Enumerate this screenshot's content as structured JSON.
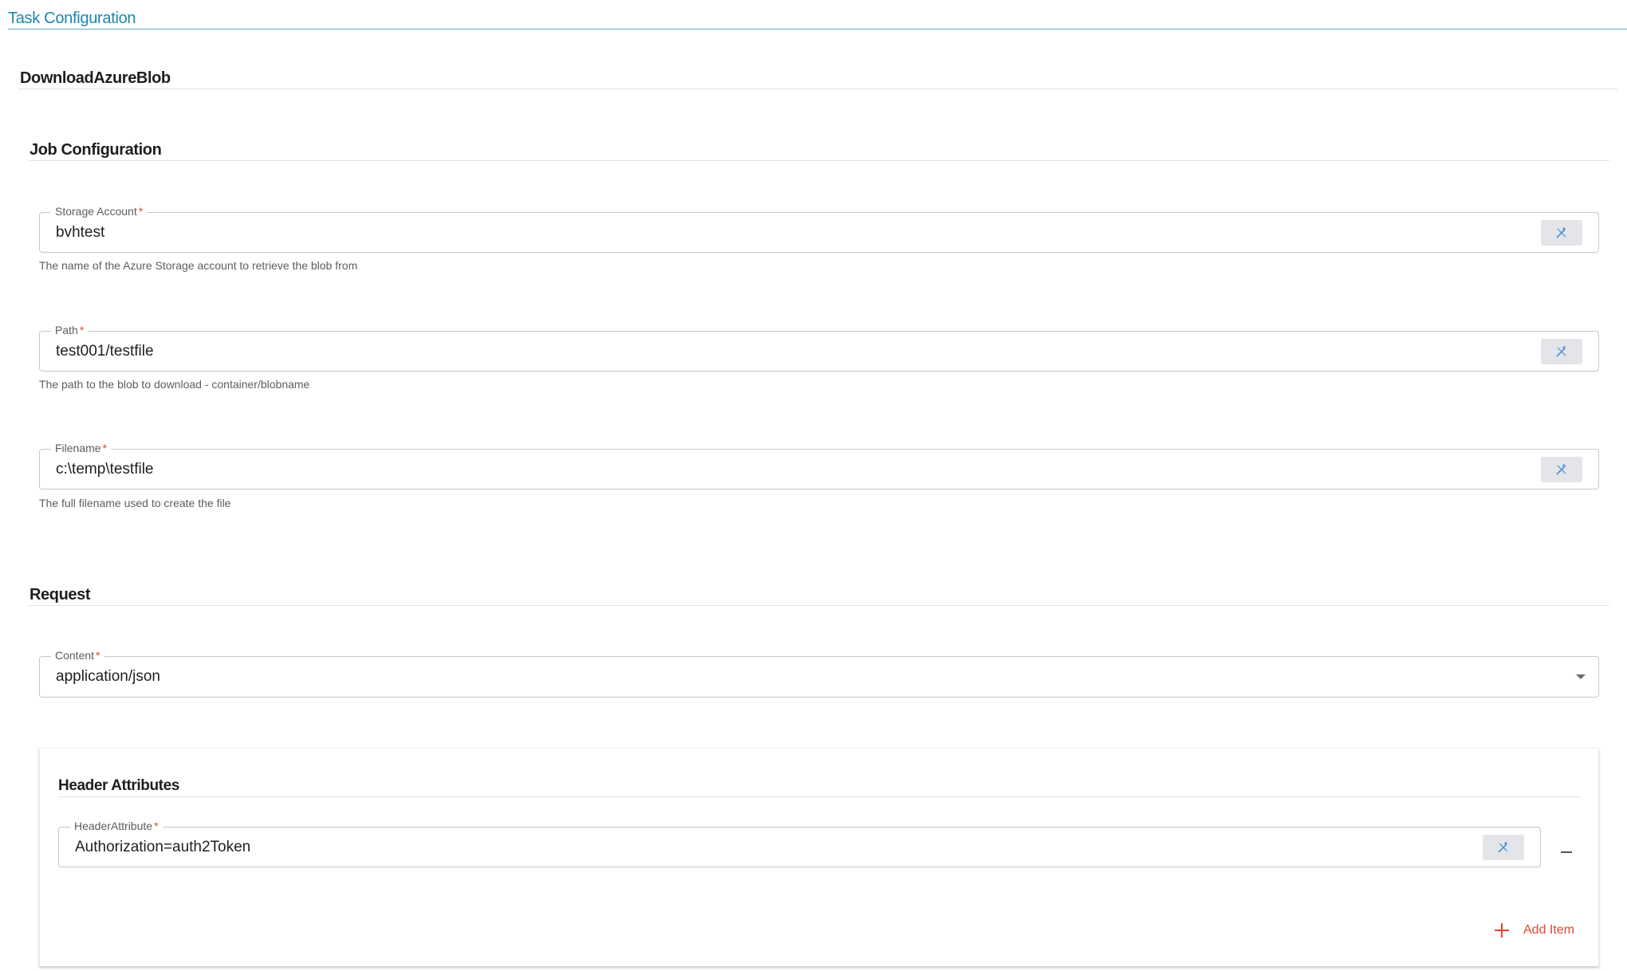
{
  "page": {
    "title": "Task Configuration"
  },
  "task": {
    "name": "DownloadAzureBlob"
  },
  "job_configuration": {
    "title": "Job Configuration",
    "storage_account": {
      "label": "Storage Account",
      "required_mark": "*",
      "value": "bvhtest",
      "hint": "The name of the Azure Storage account to retrieve the blob from"
    },
    "path": {
      "label": "Path",
      "required_mark": "*",
      "value": "test001/testfile",
      "hint": "The path to the blob to download - container/blobname"
    },
    "filename": {
      "label": "Filename",
      "required_mark": "*",
      "value": "c:\\temp\\testfile",
      "hint": "The full filename used to create the file"
    }
  },
  "request": {
    "title": "Request",
    "content": {
      "label": "Content",
      "required_mark": "*",
      "selected": "application/json"
    },
    "header_attributes": {
      "title": "Header Attributes",
      "items": [
        {
          "label": "HeaderAttribute",
          "required_mark": "*",
          "value": "Authorization=auth2Token"
        }
      ],
      "add_label": "Add Item"
    }
  },
  "icons": {
    "expression": "magic-wand-icon",
    "dropdown": "chevron-down-icon",
    "remove": "minus-icon",
    "add": "plus-icon"
  },
  "colors": {
    "accent": "#1d86ad",
    "required": "#e0472b",
    "icon_blue": "#4a8fd8",
    "button_bg": "#e3e5e8"
  }
}
